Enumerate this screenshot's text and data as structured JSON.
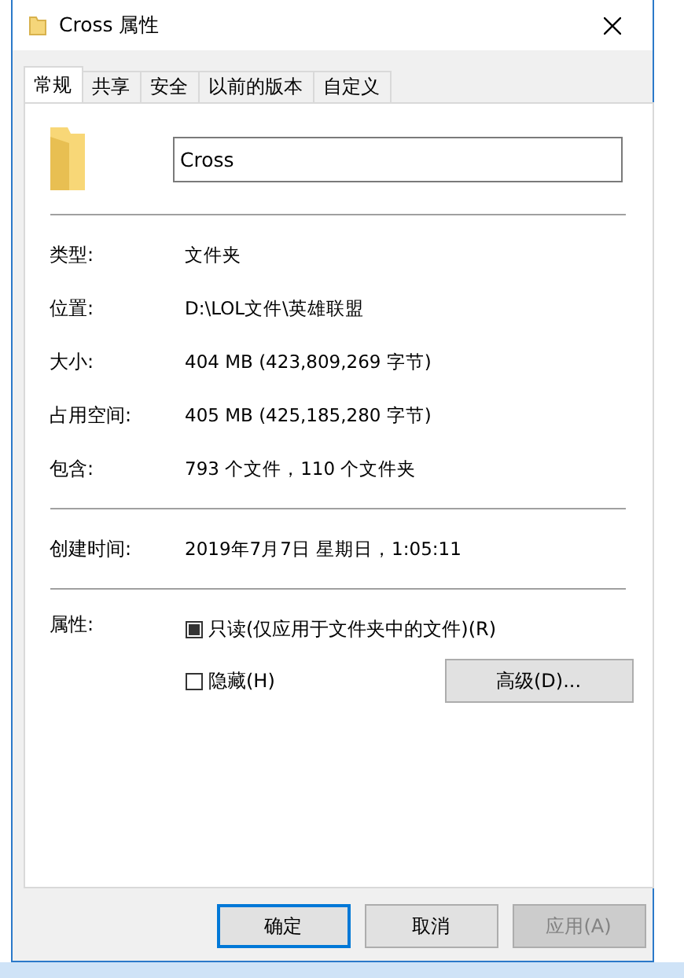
{
  "window": {
    "title": "Cross 属性"
  },
  "tabs": [
    {
      "label": "常规",
      "selected": true
    },
    {
      "label": "共享",
      "selected": false
    },
    {
      "label": "安全",
      "selected": false
    },
    {
      "label": "以前的版本",
      "selected": false
    },
    {
      "label": "自定义",
      "selected": false
    }
  ],
  "name_field": {
    "value": "Cross"
  },
  "info_groups": [
    [
      {
        "label": "类型:",
        "value": "文件夹"
      },
      {
        "label": "位置:",
        "value": "D:\\LOL文件\\英雄联盟"
      },
      {
        "label": "大小:",
        "value": "404 MB (423,809,269 字节)"
      },
      {
        "label": "占用空间:",
        "value": "405 MB (425,185,280 字节)"
      },
      {
        "label": "包含:",
        "value": "793 个文件，110 个文件夹"
      }
    ],
    [
      {
        "label": "创建时间:",
        "value": "2019年7月7日 星期日，1:05:11"
      }
    ]
  ],
  "attributes": {
    "label": "属性:",
    "options": [
      {
        "label": "只读(仅应用于文件夹中的文件)(R)",
        "checked": false,
        "mixed": true
      },
      {
        "label": "隐藏(H)",
        "checked": false,
        "mixed": false
      }
    ],
    "advanced_button": "高级(D)..."
  },
  "buttons": [
    {
      "label": "确定",
      "default": true,
      "disabled": false
    },
    {
      "label": "取消",
      "default": false,
      "disabled": false
    },
    {
      "label": "应用(A)",
      "default": false,
      "disabled": true
    }
  ]
}
